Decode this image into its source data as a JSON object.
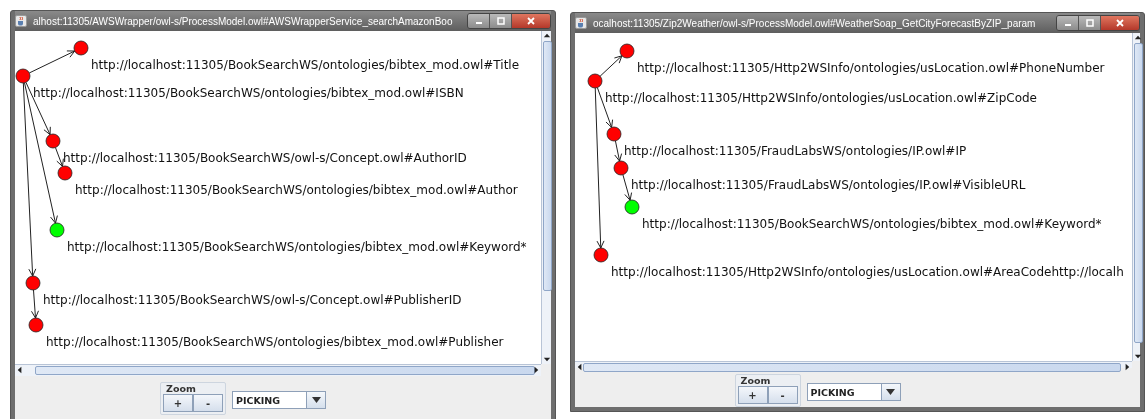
{
  "windows": [
    {
      "title": "alhost:11305/AWSWrapper/owl-s/ProcessModel.owl#AWSWrapperService_searchAmazonBoo",
      "graph": {
        "root": {
          "label": "http://localhost:11305/BookSearchWS/ontologies/bibtex_mod.owl#ISBN",
          "color": "#ff0000",
          "children": [
            {
              "label": "http://localhost:11305/BookSearchWS/ontologies/bibtex_mod.owl#Title",
              "color": "#ff0000"
            },
            {
              "label": "http://localhost:11305/BookSearchWS/owl-s/Concept.owl#AuthorID",
              "color": "#ff0000",
              "children": [
                {
                  "label": "http://localhost:11305/BookSearchWS/ontologies/bibtex_mod.owl#Author",
                  "color": "#ff0000"
                }
              ]
            },
            {
              "label": "http://localhost:11305/BookSearchWS/ontologies/bibtex_mod.owl#Keyword*",
              "color": "#00ff00"
            },
            {
              "label": "http://localhost:11305/BookSearchWS/owl-s/Concept.owl#PublisherID",
              "color": "#ff0000",
              "children": [
                {
                  "label": "http://localhost:11305/BookSearchWS/ontologies/bibtex_mod.owl#Publisher",
                  "color": "#ff0000"
                }
              ]
            }
          ]
        }
      },
      "zoom": {
        "label": "Zoom",
        "buttons": [
          "+",
          "-"
        ]
      },
      "mode": "PICKING"
    },
    {
      "title": "ocalhost:11305/Zip2Weather/owl-s/ProcessModel.owl#WeatherSoap_GetCityForecastByZIP_param",
      "graph": {
        "root": {
          "label": "http://localhost:11305/Http2WSInfo/ontologies/usLocation.owl#ZipCode",
          "color": "#ff0000",
          "children": [
            {
              "label": "http://localhost:11305/Http2WSInfo/ontologies/usLocation.owl#PhoneNumber",
              "color": "#ff0000"
            },
            {
              "label": "http://localhost:11305/FraudLabsWS/ontologies/IP.owl#IP",
              "color": "#ff0000",
              "children": [
                {
                  "label": "http://localhost:11305/FraudLabsWS/ontologies/IP.owl#VisibleURL",
                  "color": "#ff0000",
                  "children": [
                    {
                      "label": "http://localhost:11305/BookSearchWS/ontologies/bibtex_mod.owl#Keyword*",
                      "color": "#00ff00"
                    }
                  ]
                }
              ]
            },
            {
              "label": "http://localhost:11305/Http2WSInfo/ontologies/usLocation.owl#AreaCodehttp://localh",
              "color": "#ff0000"
            }
          ]
        }
      },
      "zoom": {
        "label": "Zoom",
        "buttons": [
          "+",
          "-"
        ]
      },
      "mode": "PICKING"
    }
  ]
}
